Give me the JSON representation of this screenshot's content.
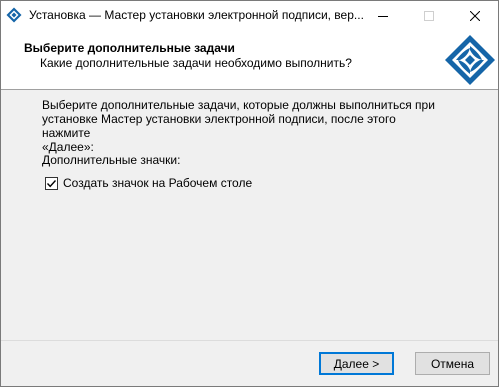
{
  "window": {
    "title": "Установка — Мастер установки электронной подписи, вер..."
  },
  "header": {
    "title": "Выберите дополнительные задачи",
    "subtitle": "Какие дополнительные задачи необходимо выполнить?"
  },
  "main": {
    "description_lines": [
      "Выберите дополнительные задачи, которые должны выполниться при",
      "установке Мастер установки электронной подписи, после этого нажмите",
      "«Далее»:"
    ],
    "group_label": "Дополнительные значки:",
    "checkbox": {
      "label": "Создать значок на Рабочем столе",
      "checked": true
    }
  },
  "buttons": {
    "next": "Далее >",
    "cancel": "Отмена"
  },
  "colors": {
    "accent": "#0078d7",
    "logo_blue": "#1565a8"
  },
  "icons": [
    "app-icon",
    "minimize-icon",
    "maximize-icon",
    "close-icon",
    "installer-logo-icon",
    "checkmark-icon"
  ]
}
